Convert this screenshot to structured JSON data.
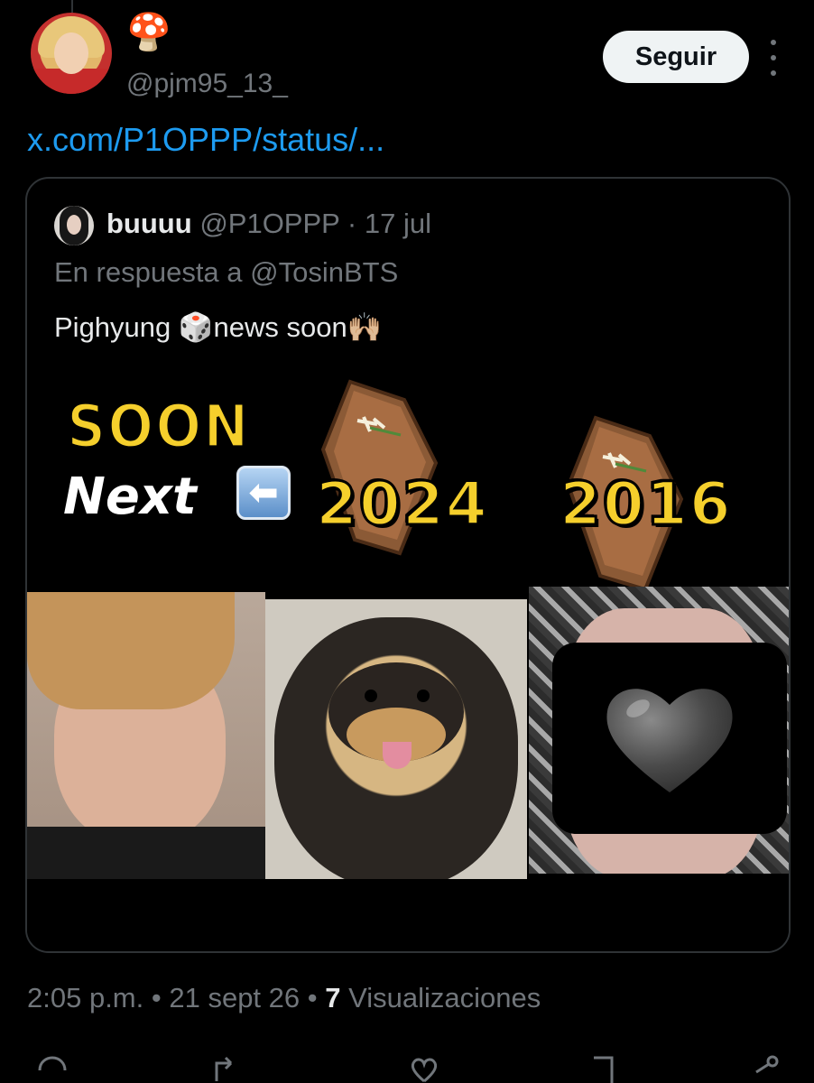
{
  "post": {
    "author_emoji": "🍄",
    "handle": "@pjm95_13_",
    "follow_label": "Seguir",
    "link": "x.com/P1OPPP/status/...",
    "timestamp": "2:05 p.m.",
    "separator": "•",
    "date": "21 sept 26",
    "views_count": "7",
    "views_label": "Visualizaciones"
  },
  "quote": {
    "name": "buuuu",
    "handle": "@P1OPPP",
    "separator": "·",
    "date": "17 jul",
    "reply_to": "En respuesta a @TosinBTS",
    "text": "Pighyung 🎲news soon🙌🏼",
    "meme": {
      "soon": "SOON",
      "next": "Next",
      "arrow": "⬅",
      "year_a": "2024",
      "year_b": "2016",
      "heart": "🖤"
    }
  },
  "actions": [
    "reply-icon",
    "repost-icon",
    "like-icon",
    "bookmark-icon",
    "share-icon"
  ],
  "colors": {
    "background": "#000000",
    "link": "#1d9bf0",
    "muted": "#71767b",
    "text": "#e7e9ea",
    "button_bg": "#eff3f4"
  }
}
